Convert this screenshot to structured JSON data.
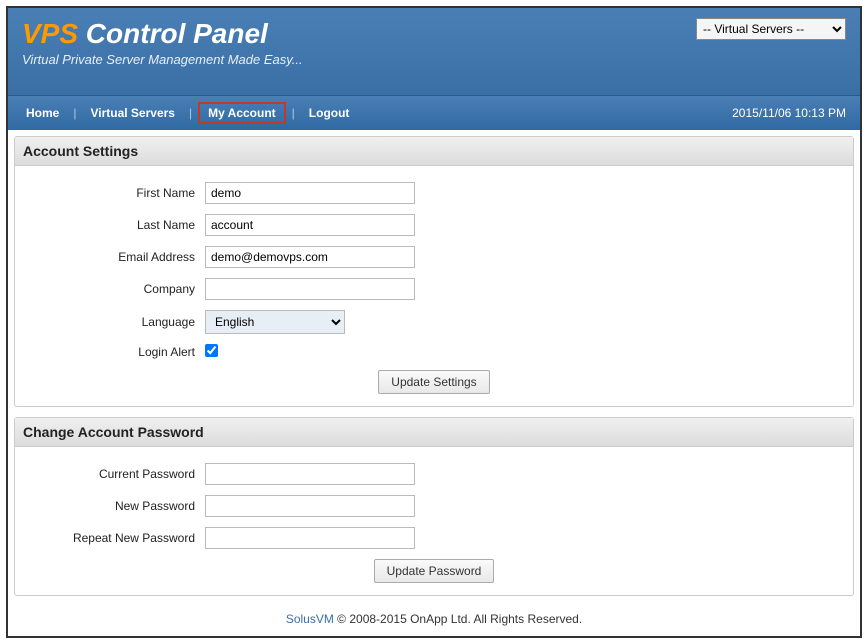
{
  "header": {
    "brand_prefix": "VPS",
    "brand_rest": " Control Panel",
    "subtitle": "Virtual Private Server Management Made Easy...",
    "dropdown_selected": "-- Virtual Servers --"
  },
  "nav": {
    "home": "Home",
    "virtual_servers": "Virtual Servers",
    "my_account": "My Account",
    "logout": "Logout",
    "timestamp": "2015/11/06 10:13 PM"
  },
  "settings_panel": {
    "title": "Account Settings",
    "first_name_label": "First Name",
    "first_name_value": "demo",
    "last_name_label": "Last Name",
    "last_name_value": "account",
    "email_label": "Email Address",
    "email_value": "demo@demovps.com",
    "company_label": "Company",
    "company_value": "",
    "language_label": "Language",
    "language_value": "English",
    "login_alert_label": "Login Alert",
    "update_button": "Update Settings"
  },
  "password_panel": {
    "title": "Change Account Password",
    "current_label": "Current Password",
    "new_label": "New Password",
    "repeat_label": "Repeat New Password",
    "update_button": "Update Password"
  },
  "footer": {
    "brand": "SolusVM",
    "text": " © 2008-2015 OnApp Ltd. All Rights Reserved."
  }
}
